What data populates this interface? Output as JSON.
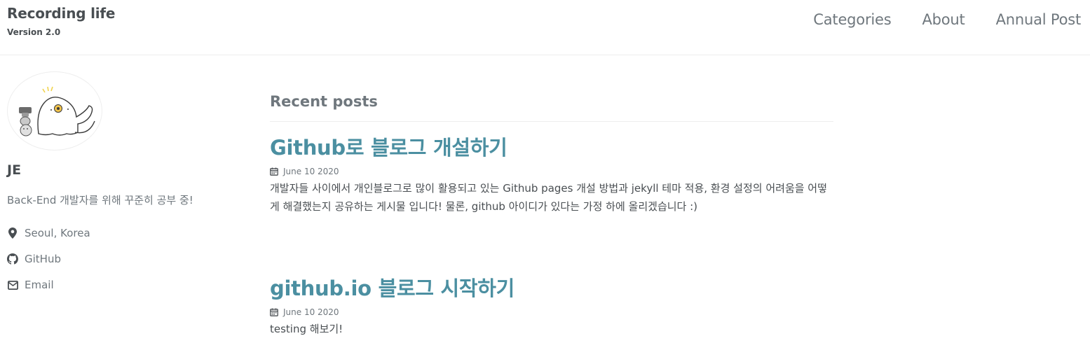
{
  "masthead": {
    "title": "Recording life",
    "subtitle": "Version 2.0",
    "nav": [
      {
        "label": "Categories"
      },
      {
        "label": "About"
      },
      {
        "label": "Annual Post"
      }
    ]
  },
  "author": {
    "name": "JE",
    "bio": "Back-End 개발자를 위해 꾸준히 공부 중!",
    "links": [
      {
        "icon": "map-marker-icon",
        "label": "Seoul, Korea"
      },
      {
        "icon": "github-icon",
        "label": "GitHub"
      },
      {
        "icon": "envelope-icon",
        "label": "Email"
      }
    ]
  },
  "main": {
    "heading": "Recent posts",
    "posts": [
      {
        "title": "Github로 블로그 개설하기",
        "date": "June 10 2020",
        "excerpt": "개발자들 사이에서 개인블로그로 많이 활용되고 있는 Github pages 개설 방법과 jekyll 테마 적용, 환경 설정의 어려움을 어떻게 해결했는지 공유하는 게시물 입니다! 물론, github 아이디가 있다는 가정 하에 올리겠습니다 :)"
      },
      {
        "title": "github.io 블로그 시작하기",
        "date": "June 10 2020",
        "excerpt": "testing 해보기!"
      }
    ]
  },
  "colors": {
    "link": "#4b8fa1",
    "text": "#494e52",
    "muted": "#6f777d",
    "border": "#eeeeee"
  }
}
